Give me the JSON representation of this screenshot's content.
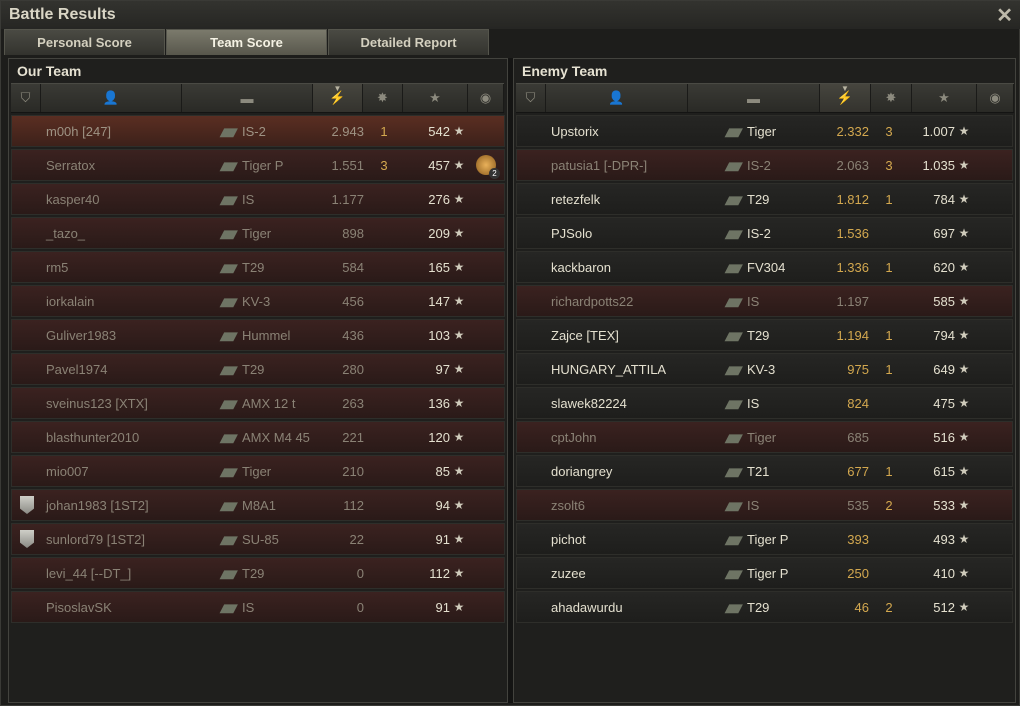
{
  "window": {
    "title": "Battle Results",
    "close_symbol": "✕"
  },
  "tabs": [
    {
      "label": "Personal Score",
      "active": false
    },
    {
      "label": "Team Score",
      "active": true
    },
    {
      "label": "Detailed Report",
      "active": false
    }
  ],
  "our_team": {
    "title": "Our Team",
    "players": [
      {
        "name": "m00h [247]",
        "tank": "IS-2",
        "damage": "2.943",
        "kills": "1",
        "xp": "542",
        "state": "self",
        "platoon": false,
        "medal": false
      },
      {
        "name": "Serratox",
        "tank": "Tiger P",
        "damage": "1.551",
        "kills": "3",
        "xp": "457",
        "state": "dead",
        "platoon": false,
        "medal": true,
        "medal_count": "2"
      },
      {
        "name": "kasper40",
        "tank": "IS",
        "damage": "1.177",
        "kills": "",
        "xp": "276",
        "state": "dead",
        "platoon": false,
        "medal": false
      },
      {
        "name": "_tazo_",
        "tank": "Tiger",
        "damage": "898",
        "kills": "",
        "xp": "209",
        "state": "dead",
        "platoon": false,
        "medal": false
      },
      {
        "name": "rm5",
        "tank": "T29",
        "damage": "584",
        "kills": "",
        "xp": "165",
        "state": "dead",
        "platoon": false,
        "medal": false
      },
      {
        "name": "iorkalain",
        "tank": "KV-3",
        "damage": "456",
        "kills": "",
        "xp": "147",
        "state": "dead",
        "platoon": false,
        "medal": false
      },
      {
        "name": "Guliver1983",
        "tank": "Hummel",
        "damage": "436",
        "kills": "",
        "xp": "103",
        "state": "dead",
        "platoon": false,
        "medal": false
      },
      {
        "name": "Pavel1974",
        "tank": "T29",
        "damage": "280",
        "kills": "",
        "xp": "97",
        "state": "dead",
        "platoon": false,
        "medal": false
      },
      {
        "name": "sveinus123 [XTX]",
        "tank": "AMX 12 t",
        "damage": "263",
        "kills": "",
        "xp": "136",
        "state": "dead",
        "platoon": false,
        "medal": false
      },
      {
        "name": "blasthunter2010",
        "tank": "AMX M4 45",
        "damage": "221",
        "kills": "",
        "xp": "120",
        "state": "dead",
        "platoon": false,
        "medal": false
      },
      {
        "name": "mio007",
        "tank": "Tiger",
        "damage": "210",
        "kills": "",
        "xp": "85",
        "state": "dead",
        "platoon": false,
        "medal": false
      },
      {
        "name": "johan1983 [1ST2]",
        "tank": "M8A1",
        "damage": "112",
        "kills": "",
        "xp": "94",
        "state": "dead",
        "platoon": true,
        "medal": false
      },
      {
        "name": "sunlord79 [1ST2]",
        "tank": "SU-85",
        "damage": "22",
        "kills": "",
        "xp": "91",
        "state": "dead",
        "platoon": true,
        "medal": false
      },
      {
        "name": "levi_44 [--DT_]",
        "tank": "T29",
        "damage": "0",
        "kills": "",
        "xp": "112",
        "state": "dead",
        "platoon": false,
        "medal": false
      },
      {
        "name": "PisoslavSK",
        "tank": "IS",
        "damage": "0",
        "kills": "",
        "xp": "91",
        "state": "dead",
        "platoon": false,
        "medal": false
      }
    ]
  },
  "enemy_team": {
    "title": "Enemy Team",
    "players": [
      {
        "name": "Upstorix",
        "tank": "Tiger",
        "damage": "2.332",
        "kills": "3",
        "xp": "1.007",
        "state": "alive"
      },
      {
        "name": "patusia1 [-DPR-]",
        "tank": "IS-2",
        "damage": "2.063",
        "kills": "3",
        "xp": "1.035",
        "state": "dead"
      },
      {
        "name": "retezfelk",
        "tank": "T29",
        "damage": "1.812",
        "kills": "1",
        "xp": "784",
        "state": "alive"
      },
      {
        "name": "PJSolo",
        "tank": "IS-2",
        "damage": "1.536",
        "kills": "",
        "xp": "697",
        "state": "alive"
      },
      {
        "name": "kackbaron",
        "tank": "FV304",
        "damage": "1.336",
        "kills": "1",
        "xp": "620",
        "state": "alive"
      },
      {
        "name": "richardpotts22",
        "tank": "IS",
        "damage": "1.197",
        "kills": "",
        "xp": "585",
        "state": "dead"
      },
      {
        "name": "Zajce [TEX]",
        "tank": "T29",
        "damage": "1.194",
        "kills": "1",
        "xp": "794",
        "state": "alive"
      },
      {
        "name": "HUNGARY_ATTILA",
        "tank": "KV-3",
        "damage": "975",
        "kills": "1",
        "xp": "649",
        "state": "alive"
      },
      {
        "name": "slawek82224",
        "tank": "IS",
        "damage": "824",
        "kills": "",
        "xp": "475",
        "state": "alive"
      },
      {
        "name": "cptJohn",
        "tank": "Tiger",
        "damage": "685",
        "kills": "",
        "xp": "516",
        "state": "dead"
      },
      {
        "name": "doriangrey",
        "tank": "T21",
        "damage": "677",
        "kills": "1",
        "xp": "615",
        "state": "alive"
      },
      {
        "name": "zsolt6",
        "tank": "IS",
        "damage": "535",
        "kills": "2",
        "xp": "533",
        "state": "dead"
      },
      {
        "name": "pichot",
        "tank": "Tiger P",
        "damage": "393",
        "kills": "",
        "xp": "493",
        "state": "alive"
      },
      {
        "name": "zuzee",
        "tank": "Tiger P",
        "damage": "250",
        "kills": "",
        "xp": "410",
        "state": "alive"
      },
      {
        "name": "ahadawurdu",
        "tank": "T29",
        "damage": "46",
        "kills": "2",
        "xp": "512",
        "state": "alive"
      }
    ]
  },
  "columns": [
    {
      "icon": "platoon-icon",
      "symbol": "⛉"
    },
    {
      "icon": "player-icon",
      "symbol": "👤"
    },
    {
      "icon": "tank-icon",
      "symbol": "▬"
    },
    {
      "icon": "damage-icon",
      "symbol": "⚡",
      "sorted": true
    },
    {
      "icon": "kills-icon",
      "symbol": "✸"
    },
    {
      "icon": "xp-icon",
      "symbol": "★"
    },
    {
      "icon": "medal-icon",
      "symbol": "◉"
    }
  ],
  "colors": {
    "alive_text": "#e4e0cf",
    "dead_row": "#3b2220",
    "self_row": "#5a2e22",
    "accent": "#d3a84f"
  }
}
